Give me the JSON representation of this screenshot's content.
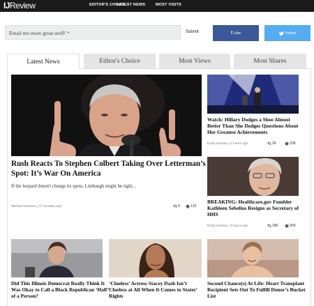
{
  "brand": {
    "logo_bold": "IJ",
    "logo_light": "Review"
  },
  "nav": {
    "items": [
      "EDITOR'S CHOICE",
      "LATEST NEWS",
      "MOST VISITS"
    ]
  },
  "subscribe": {
    "placeholder": "Email me more great stuff! *",
    "submit_label": "Submit",
    "like_label": "Like",
    "follow_label": "Follow"
  },
  "tabs": [
    "Latest News",
    "Editor's Choice",
    "Most Views",
    "Most Shares"
  ],
  "featured": {
    "title": "Rush Reacts To Stephen Colbert Taking Over Letterman’s Spot: It’s War On America",
    "dek": "If the leopard doesn't change its spots, Limbaugh might be right...",
    "author": "Michael Hausam | 47 minutes ago",
    "shares": "4",
    "views": "133"
  },
  "side_articles": [
    {
      "title": "Watch: Hillary Dodges a Shoe Almost Better Than She Dodges Questions About Her Greatest Achievements",
      "author": "Emily Hussey | 2 hours ago",
      "shares": "2K",
      "views": "23K"
    },
    {
      "title": "BREAKING: Healthcare.gov Fumbler Kathleen Sebelius Resigns as Secretary of HHS",
      "author": "Emily Hussey | 3 hours ago",
      "shares": "18K",
      "views": "56K"
    }
  ],
  "bottom_articles": [
    {
      "title": "Did This Illinois Democrat Really Think It Was Okay to Call a Black Republican ‘Half’ of a Person?"
    },
    {
      "title": "‘Clueless’ Actress Stacey Dash Isn’t Clueless at All When It Comes to States’ Rights"
    },
    {
      "title": "Second Chance(s) At Life: Heart Transplant Recipient Sets Out To Fulfill Donor’s Bucket List"
    }
  ],
  "colors": {
    "topbar": "#1a1a1a",
    "facebook": "#3b5998",
    "twitter": "#55acee"
  }
}
